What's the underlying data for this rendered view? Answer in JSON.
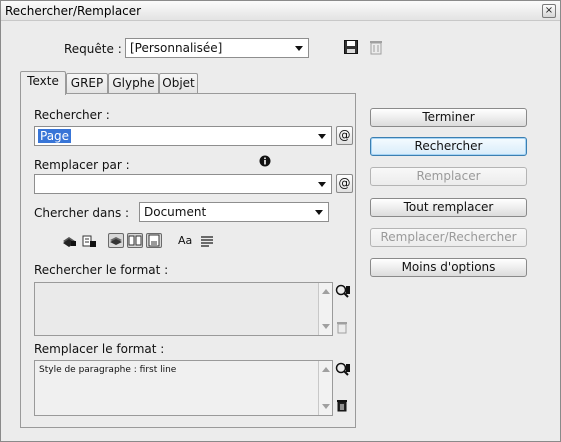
{
  "window": {
    "title": "Rechercher/Remplacer",
    "close_glyph": "×"
  },
  "query": {
    "label": "Requête :",
    "value": "[Personnalisée]",
    "save_icon": "save-query-icon",
    "delete_icon": "delete-query-icon"
  },
  "tabs": [
    {
      "label": "Texte",
      "active": true
    },
    {
      "label": "GREP",
      "active": false
    },
    {
      "label": "Glyphe",
      "active": false
    },
    {
      "label": "Objet",
      "active": false
    }
  ],
  "find": {
    "label": "Rechercher :",
    "value": "Page",
    "special_char_label": "@"
  },
  "replace": {
    "label": "Remplacer par :",
    "value": "",
    "special_char_label": "@",
    "info_icon": "info-icon"
  },
  "search_in": {
    "label": "Chercher dans :",
    "value": "Document"
  },
  "options": [
    {
      "name": "include-locked-layers-icon",
      "toggled": false
    },
    {
      "name": "include-locked-stories-icon",
      "toggled": false
    },
    {
      "name": "include-hidden-layers-icon",
      "toggled": true
    },
    {
      "name": "include-master-pages-icon",
      "toggled": true
    },
    {
      "name": "include-footnotes-icon",
      "toggled": true
    },
    {
      "name": "case-sensitive-icon",
      "toggled": false,
      "glyph": "Aa"
    },
    {
      "name": "whole-word-icon",
      "toggled": false
    }
  ],
  "find_format": {
    "label": "Rechercher le format :",
    "value": ""
  },
  "replace_format": {
    "label": "Remplacer le format :",
    "value": "Style de paragraphe : first line"
  },
  "buttons": {
    "done": "Terminer",
    "find": "Rechercher",
    "replace": "Remplacer",
    "replace_all": "Tout remplacer",
    "replace_find": "Remplacer/Rechercher",
    "fewer_options": "Moins d'options"
  },
  "colors": {
    "selection": "#3875d7",
    "default_button": "#3c7fb1",
    "disabled_text": "#9a9a9a"
  }
}
